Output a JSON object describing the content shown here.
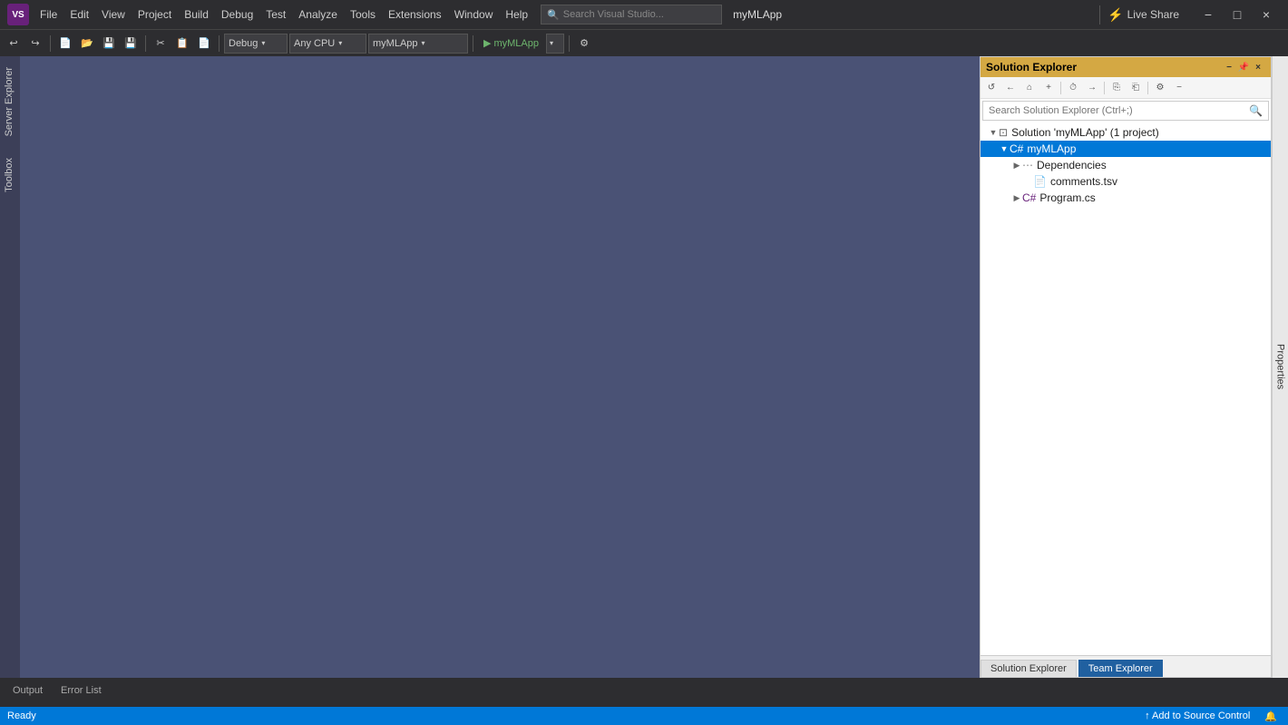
{
  "titlebar": {
    "logo_text": "VS",
    "app_title": "myMLApp",
    "menu_items": [
      "File",
      "Edit",
      "View",
      "Project",
      "Build",
      "Debug",
      "Test",
      "Analyze",
      "Tools",
      "Extensions",
      "Window",
      "Help"
    ],
    "search_placeholder": "Search Visual Studio...",
    "live_share_label": "Live Share",
    "win_minimize": "−",
    "win_maximize": "□",
    "win_close": "×"
  },
  "toolbar": {
    "debug_label": "Debug",
    "debug_arrow": "▾",
    "cpu_label": "Any CPU",
    "cpu_arrow": "▾",
    "project_label": "myMLApp",
    "project_arrow": "▾",
    "run_label": "▶ myMLApp",
    "run_arrow": "▾"
  },
  "left_tabs": {
    "server_explorer": "Server Explorer",
    "toolbox": "Toolbox"
  },
  "solution_explorer": {
    "title": "Solution Explorer",
    "search_placeholder": "Search Solution Explorer (Ctrl+;)",
    "solution_label": "Solution 'myMLApp' (1 project)",
    "project_label": "myMLApp",
    "dependencies_label": "Dependencies",
    "file1_label": "comments.tsv",
    "file2_label": "Program.cs",
    "bottom_tab1": "Solution Explorer",
    "bottom_tab2": "Team Explorer"
  },
  "properties_panel": {
    "label": "Properties"
  },
  "bottom_tabs": {
    "tab1": "Output",
    "tab2": "Error List"
  },
  "status_bar": {
    "ready_text": "Ready",
    "source_control": "↑ Add to Source Control",
    "notification_icon": "🔔"
  }
}
